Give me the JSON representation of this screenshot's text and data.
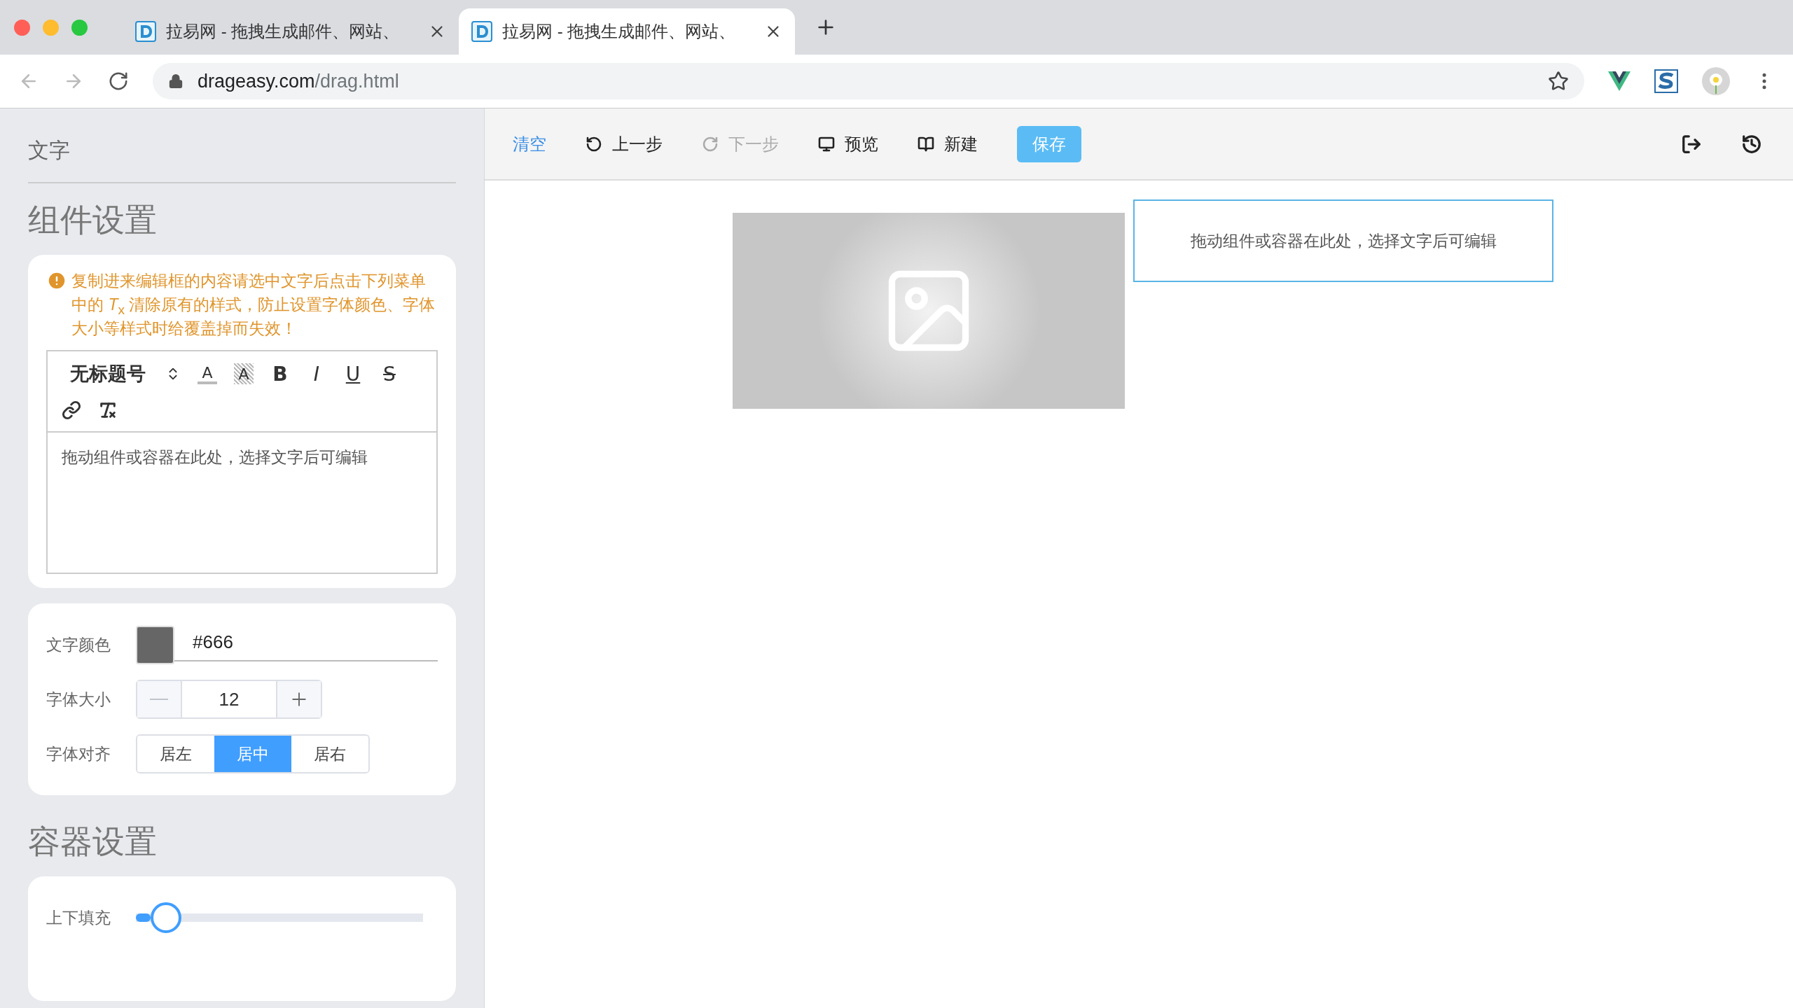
{
  "browser": {
    "tabs": [
      {
        "title": "拉易网 - 拖拽生成邮件、网站、",
        "selected": false
      },
      {
        "title": "拉易网 - 拖拽生成邮件、网站、",
        "selected": true
      }
    ],
    "url_host": "drageasy.com",
    "url_path": "/drag.html"
  },
  "sidebar": {
    "section_label": "文字",
    "component_settings": {
      "heading": "组件设置",
      "warning": "复制进来编辑框的内容请选中文字后点击下列菜单中的 *T*$_{x}$ 清除原有的样式，防止设置字体颜色、字体大小等样式时给覆盖掉而失效！",
      "editor": {
        "header_select": "无标题号",
        "tools": [
          {
            "kind": "color",
            "glyph": "A"
          },
          {
            "kind": "background",
            "glyph": "A"
          },
          {
            "kind": "bold",
            "glyph": "B"
          },
          {
            "kind": "italic",
            "glyph": "I"
          },
          {
            "kind": "underline",
            "glyph": "U"
          },
          {
            "kind": "strike",
            "glyph": "S"
          },
          {
            "kind": "link"
          },
          {
            "kind": "clean"
          }
        ],
        "content": "拖动组件或容器在此处，选择文字后可编辑"
      },
      "text_color": {
        "label": "文字颜色",
        "value": "#666"
      },
      "font_size": {
        "label": "字体大小",
        "value": "12"
      },
      "align": {
        "label": "字体对齐",
        "options": [
          {
            "label": "居左",
            "selected": false
          },
          {
            "label": "居中",
            "selected": true
          },
          {
            "label": "居右",
            "selected": false
          }
        ]
      }
    },
    "container_settings": {
      "heading": "容器设置",
      "sliders": [
        {
          "label": "上下填充",
          "level": 0.1
        }
      ]
    }
  },
  "toolbar": {
    "buttons": [
      {
        "kind": "clear",
        "label": "清空",
        "disabled": false
      },
      {
        "kind": "undo",
        "label": "上一步",
        "disabled": false
      },
      {
        "kind": "redo",
        "label": "下一步",
        "disabled": true
      },
      {
        "kind": "preview",
        "label": "预览",
        "disabled": false
      },
      {
        "kind": "new",
        "label": "新建",
        "disabled": false
      },
      {
        "kind": "save",
        "label": "保存",
        "disabled": false
      }
    ]
  },
  "canvas": {
    "text_block": "拖动组件或容器在此处，选择文字后可编辑"
  }
}
